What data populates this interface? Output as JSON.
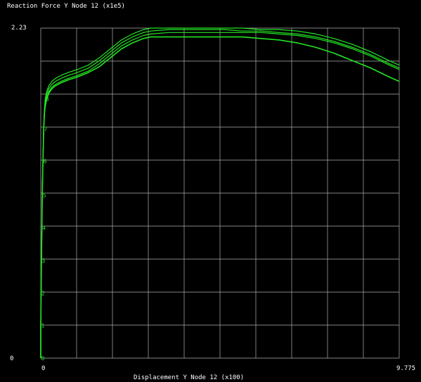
{
  "chart_data": {
    "type": "line",
    "title": "Reaction Force Y Node 12 (x1e5)",
    "xlabel": "Displacement Y Node 12 (x100)",
    "ylabel": "",
    "xlim": [
      0,
      9.775
    ],
    "ylim": [
      0,
      2.23
    ],
    "x_tick_labels": [
      "0",
      "9.775"
    ],
    "y_tick_labels": [
      "0",
      "2.23"
    ],
    "grid": true,
    "grid_divisions": 10,
    "colors": {
      "background": "#000000",
      "grid": "#b0b0b0",
      "curve": "#22e622",
      "text": "#ffffff"
    },
    "point_labels": [
      {
        "label": "0",
        "x": 0.0,
        "y": 0.0
      },
      {
        "label": "1",
        "x": 0.0,
        "y": 0.22
      },
      {
        "label": "2",
        "x": 0.01,
        "y": 0.44
      },
      {
        "label": "3",
        "x": 0.02,
        "y": 0.66
      },
      {
        "label": "4",
        "x": 0.03,
        "y": 0.88
      },
      {
        "label": "5",
        "x": 0.04,
        "y": 1.1
      },
      {
        "label": "6",
        "x": 0.06,
        "y": 1.33
      },
      {
        "label": "7",
        "x": 0.08,
        "y": 1.55
      },
      {
        "label": "8",
        "x": 0.12,
        "y": 1.75
      }
    ],
    "series": [
      {
        "x": [
          0,
          0.0,
          0.01,
          0.02,
          0.03,
          0.04,
          0.06,
          0.08,
          0.1,
          0.12,
          0.16,
          0.22,
          0.3,
          0.4,
          0.55,
          0.75,
          1.0,
          1.3,
          1.6,
          1.9,
          2.2,
          2.5,
          2.8,
          3.0,
          3.5,
          4.0,
          4.5,
          5.0,
          5.5,
          6.0,
          6.5,
          7.0,
          7.5,
          8.0,
          8.5,
          9.0,
          9.5,
          9.775
        ],
        "y": [
          0,
          0.22,
          0.44,
          0.66,
          0.88,
          1.1,
          1.33,
          1.55,
          1.68,
          1.75,
          1.8,
          1.84,
          1.87,
          1.89,
          1.91,
          1.93,
          1.95,
          1.98,
          2.03,
          2.09,
          2.15,
          2.19,
          2.22,
          2.23,
          2.23,
          2.23,
          2.23,
          2.23,
          2.23,
          2.22,
          2.22,
          2.21,
          2.19,
          2.16,
          2.12,
          2.07,
          2.01,
          1.98
        ]
      },
      {
        "x": [
          0,
          0.0,
          0.01,
          0.02,
          0.03,
          0.04,
          0.06,
          0.08,
          0.1,
          0.12,
          0.16,
          0.22,
          0.3,
          0.4,
          0.55,
          0.75,
          1.0,
          1.3,
          1.6,
          1.9,
          2.2,
          2.5,
          2.8,
          3.0,
          3.5,
          4.0,
          4.5,
          5.0,
          5.5,
          6.0,
          6.5,
          7.0,
          7.5,
          8.0,
          8.5,
          9.0,
          9.5,
          9.775
        ],
        "y": [
          0,
          0.22,
          0.44,
          0.66,
          0.88,
          1.1,
          1.33,
          1.55,
          1.67,
          1.73,
          1.78,
          1.82,
          1.85,
          1.87,
          1.89,
          1.91,
          1.93,
          1.96,
          2.01,
          2.07,
          2.13,
          2.17,
          2.2,
          2.21,
          2.22,
          2.22,
          2.22,
          2.22,
          2.21,
          2.21,
          2.2,
          2.19,
          2.17,
          2.14,
          2.1,
          2.05,
          1.99,
          1.96
        ]
      },
      {
        "x": [
          0,
          0.0,
          0.01,
          0.02,
          0.03,
          0.04,
          0.06,
          0.08,
          0.1,
          0.12,
          0.16,
          0.22,
          0.3,
          0.4,
          0.55,
          0.75,
          1.0,
          1.3,
          1.6,
          1.9,
          2.2,
          2.5,
          2.8,
          3.0,
          3.5,
          4.0,
          4.5,
          5.0,
          5.5,
          6.0,
          6.5,
          7.0,
          7.5,
          8.0,
          8.5,
          9.0,
          9.5,
          9.775
        ],
        "y": [
          0,
          0.22,
          0.44,
          0.66,
          0.88,
          1.1,
          1.33,
          1.55,
          1.66,
          1.71,
          1.76,
          1.8,
          1.83,
          1.85,
          1.87,
          1.89,
          1.91,
          1.94,
          1.99,
          2.05,
          2.11,
          2.15,
          2.18,
          2.19,
          2.2,
          2.2,
          2.2,
          2.2,
          2.2,
          2.2,
          2.19,
          2.18,
          2.16,
          2.13,
          2.09,
          2.04,
          1.98,
          1.95
        ]
      },
      {
        "x": [
          0,
          0.0,
          0.01,
          0.02,
          0.03,
          0.04,
          0.06,
          0.08,
          0.1,
          0.12,
          0.16,
          0.22,
          0.3,
          0.4,
          0.55,
          0.75,
          1.0,
          1.3,
          1.6,
          1.9,
          2.2,
          2.5,
          2.8,
          3.0,
          3.5,
          4.0,
          4.5,
          5.0,
          5.5,
          6.0,
          6.5,
          7.0,
          7.5,
          8.0,
          8.5,
          9.0,
          9.5,
          9.775
        ],
        "y": [
          0,
          0.22,
          0.44,
          0.66,
          0.88,
          1.1,
          1.33,
          1.55,
          1.65,
          1.7,
          1.75,
          1.79,
          1.82,
          1.84,
          1.86,
          1.88,
          1.9,
          1.93,
          1.97,
          2.03,
          2.09,
          2.13,
          2.16,
          2.17,
          2.17,
          2.17,
          2.17,
          2.17,
          2.17,
          2.16,
          2.15,
          2.13,
          2.1,
          2.06,
          2.01,
          1.96,
          1.9,
          1.87
        ]
      }
    ]
  }
}
